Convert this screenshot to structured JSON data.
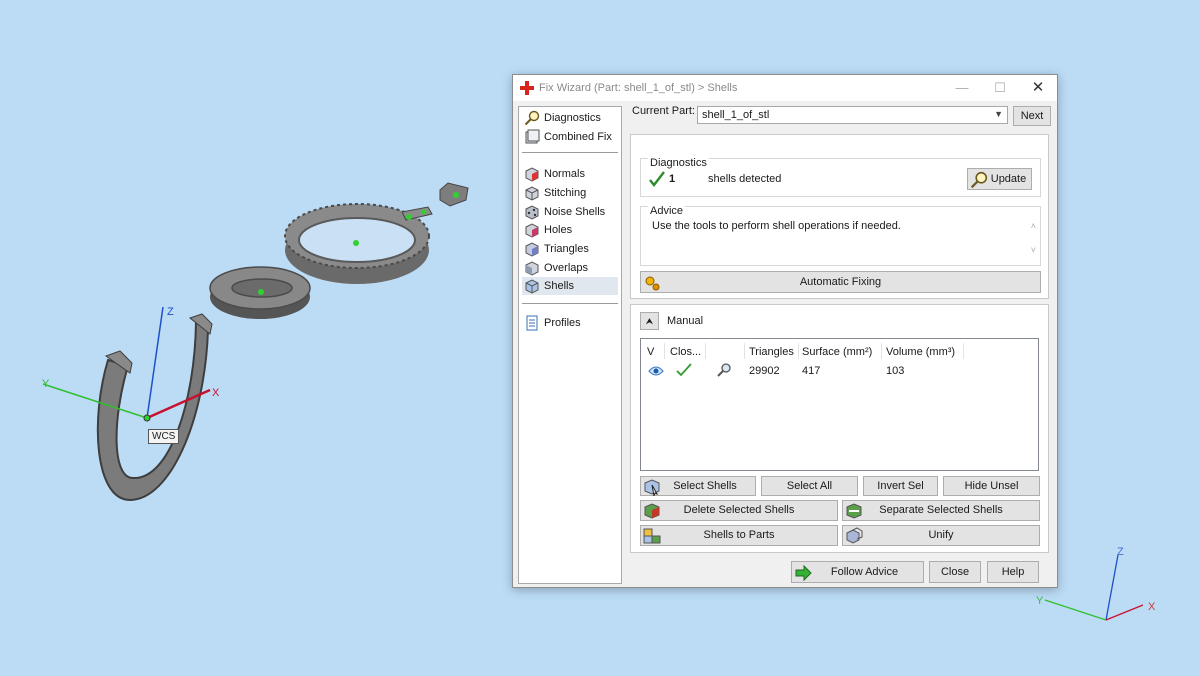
{
  "window": {
    "title": "Fix Wizard (Part: shell_1_of_stl) > Shells",
    "controls": {
      "minimize": "—",
      "maximize": "☐",
      "close": "✕"
    }
  },
  "nav": {
    "items": [
      {
        "label": "Diagnostics",
        "icon": "magnifier-icon"
      },
      {
        "label": "Combined Fix",
        "icon": "combined-fix-icon"
      },
      {
        "label": "Normals",
        "icon": "normals-cube-icon"
      },
      {
        "label": "Stitching",
        "icon": "stitching-cube-icon"
      },
      {
        "label": "Noise Shells",
        "icon": "noise-shells-icon"
      },
      {
        "label": "Holes",
        "icon": "holes-cube-icon"
      },
      {
        "label": "Triangles",
        "icon": "triangles-cube-icon"
      },
      {
        "label": "Overlaps",
        "icon": "overlaps-cube-icon"
      },
      {
        "label": "Shells",
        "icon": "shells-cube-icon"
      },
      {
        "label": "Profiles",
        "icon": "profiles-document-icon"
      }
    ],
    "active": "Shells"
  },
  "current_part": {
    "label": "Current Part:",
    "value": "shell_1_of_stl",
    "next_label": "Next"
  },
  "diagnostics": {
    "title": "Diagnostics",
    "count": "1",
    "text": "shells detected",
    "update_label": "Update",
    "status_color": "#2e8b2e"
  },
  "advice": {
    "title": "Advice",
    "text": "Use the tools to perform shell operations if needed."
  },
  "auto_fix_label": "Automatic Fixing",
  "manual": {
    "collapse_glyph": "⮝",
    "label": "Manual",
    "columns": [
      "V",
      "Clos...",
      "Triangles",
      "Surface (mm²)",
      "Volume (mm³)"
    ],
    "rows": [
      {
        "triangles": "29902",
        "surface": "417",
        "volume": "103"
      }
    ]
  },
  "buttons": {
    "select_shells": "Select Shells",
    "select_all": "Select All",
    "invert_sel": "Invert Sel",
    "hide_unsel": "Hide Unsel",
    "delete_selected": "Delete Selected Shells",
    "separate_selected": "Separate Selected Shells",
    "shells_to_parts": "Shells to Parts",
    "unify": "Unify",
    "follow_advice": "Follow Advice",
    "close": "Close",
    "help": "Help"
  },
  "viewport": {
    "wcs_label": "WCS",
    "axes": {
      "x": "X",
      "y": "Y",
      "z": "Z"
    },
    "small_axes": {
      "x": "X",
      "y": "Y",
      "z": "Z"
    },
    "colors": {
      "x": "#c8102e",
      "y": "#2fbf2f",
      "z": "#1e50c8",
      "background": "#bcdcf6"
    }
  }
}
